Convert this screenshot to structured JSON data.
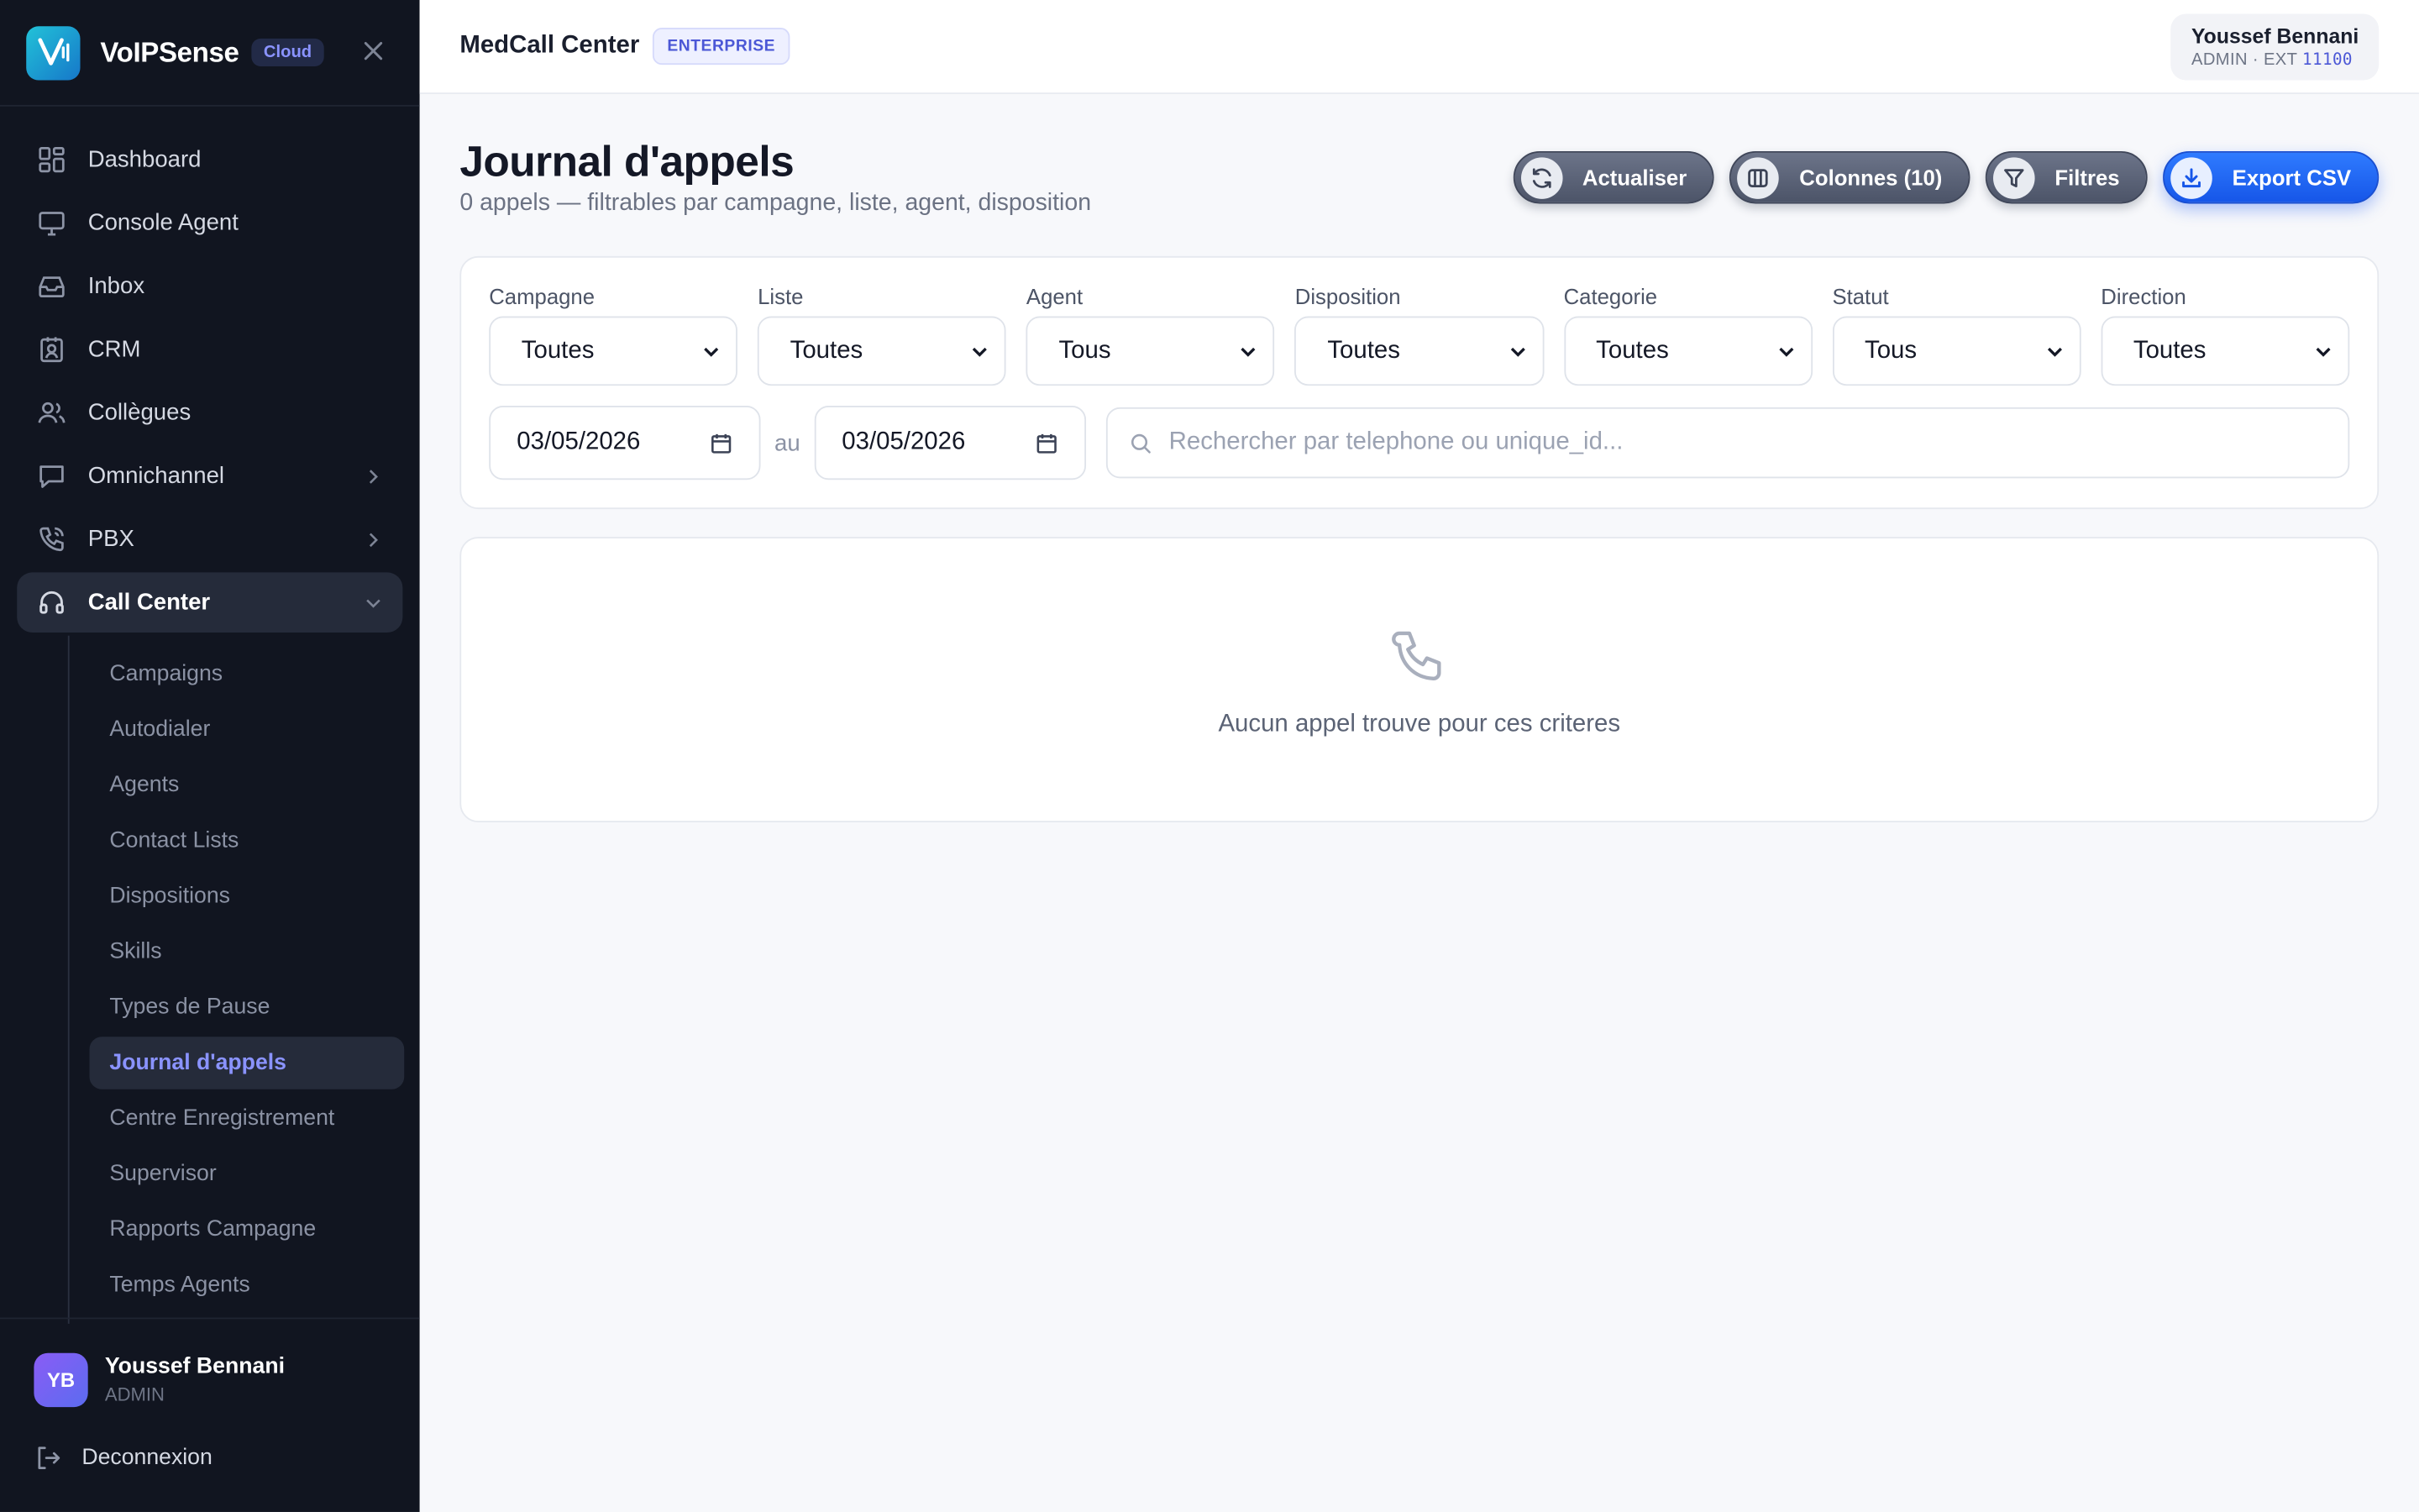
{
  "brand": {
    "name": "VoIPSense",
    "badge": "Cloud"
  },
  "sidebar": {
    "items": [
      {
        "label": "Dashboard",
        "icon": "dashboard-icon"
      },
      {
        "label": "Console Agent",
        "icon": "monitor-icon"
      },
      {
        "label": "Inbox",
        "icon": "inbox-icon"
      },
      {
        "label": "CRM",
        "icon": "contact-card-icon"
      },
      {
        "label": "Collègues",
        "icon": "users-icon"
      },
      {
        "label": "Omnichannel",
        "icon": "chat-icon"
      },
      {
        "label": "PBX",
        "icon": "phone-icon"
      },
      {
        "label": "Call Center",
        "icon": "headset-icon"
      }
    ],
    "sub_items": [
      "Campaigns",
      "Autodialer",
      "Agents",
      "Contact Lists",
      "Dispositions",
      "Skills",
      "Types de Pause",
      "Journal d'appels",
      "Centre Enregistrement",
      "Supervisor",
      "Rapports Campagne",
      "Temps Agents"
    ],
    "active_sub": "Journal d'appels",
    "user": {
      "initials": "YB",
      "name": "Youssef Bennani",
      "role": "ADMIN"
    },
    "logout": "Deconnexion"
  },
  "topbar": {
    "org": "MedCall Center",
    "plan": "ENTERPRISE",
    "user_name": "Youssef Bennani",
    "user_meta": "ADMIN · EXT",
    "user_ext": "11100"
  },
  "page": {
    "title": "Journal d'appels",
    "subtitle": "0 appels — filtrables par campagne, liste, agent, disposition",
    "actions": {
      "refresh": "Actualiser",
      "columns": "Colonnes (10)",
      "filters": "Filtres",
      "export": "Export CSV"
    }
  },
  "filters": {
    "campaign": {
      "label": "Campagne",
      "value": "Toutes"
    },
    "list": {
      "label": "Liste",
      "value": "Toutes"
    },
    "agent": {
      "label": "Agent",
      "value": "Tous"
    },
    "disposition": {
      "label": "Disposition",
      "value": "Toutes"
    },
    "category": {
      "label": "Categorie",
      "value": "Toutes"
    },
    "status": {
      "label": "Statut",
      "value": "Tous"
    },
    "direction": {
      "label": "Direction",
      "value": "Toutes"
    },
    "date_from": "03/05/2026",
    "date_sep": "au",
    "date_to": "03/05/2026",
    "search_placeholder": "Rechercher par telephone ou unique_id..."
  },
  "empty": {
    "message": "Aucun appel trouve pour ces criteres"
  },
  "colors": {
    "sidebar_bg": "#111520",
    "accent": "#8a93ff",
    "primary_button": "#1656e8"
  }
}
